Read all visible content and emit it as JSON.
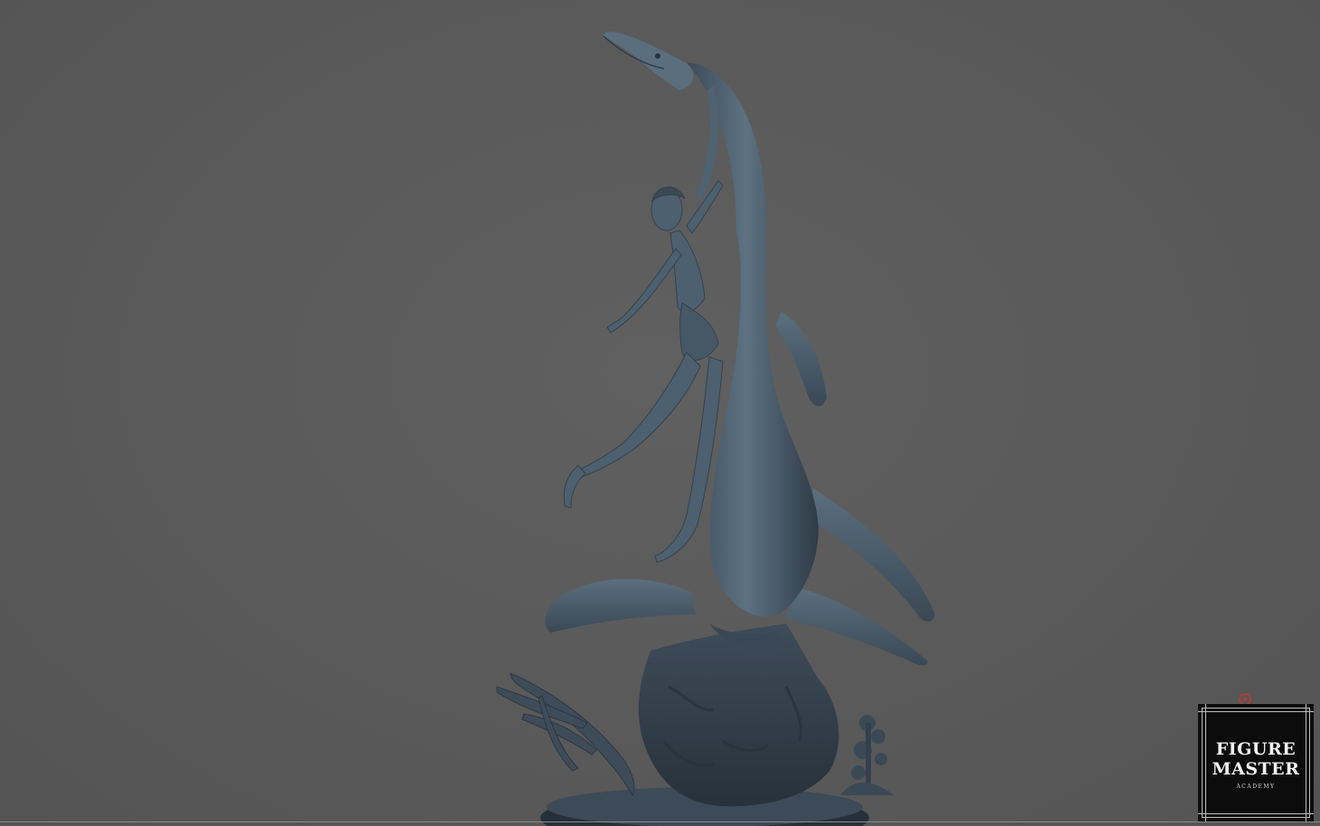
{
  "scene": {
    "background_color": "#5b5b5b",
    "sculpture_color": "#4a5b6a",
    "subject": "3D sculpt"
  },
  "logo": {
    "line1": "FIGURE",
    "line2": "MASTER",
    "line3": "ACADEMY"
  },
  "icons": {
    "mark": "red-circle-icon"
  }
}
